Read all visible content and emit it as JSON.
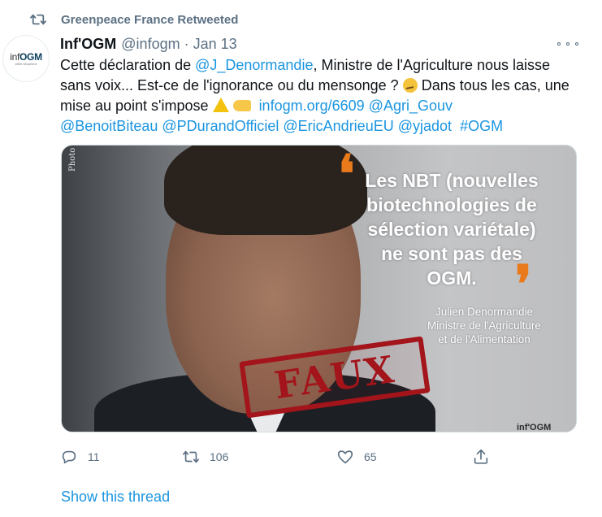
{
  "social_context": {
    "icon": "retweet-icon",
    "text": "Greenpeace France Retweeted"
  },
  "author": {
    "name": "Inf'OGM",
    "handle": "@infogm",
    "separator": "·",
    "date": "Jan 13",
    "avatar_logo_inf": "inf",
    "avatar_logo_ogm": "OGM",
    "avatar_tagline": "veille citoyenne"
  },
  "tweet": {
    "t1": "Cette déclaration de ",
    "mention_1": "@J_Denormandie",
    "t2": ", Ministre de l'Agriculture nous laisse sans voix... Est-ce de l'ignorance ou du mensonge ? ",
    "t3": " Dans tous les cas, une mise au point s'impose ",
    "link": "infogm.org/6609",
    "mention_2": "@Agri_Gouv",
    "mention_3": "@BenoitBiteau",
    "mention_4": "@PDurandOfficiel",
    "mention_5": "@EricAndrieuEU",
    "mention_6": "@yjadot",
    "hashtag": "#OGM",
    "emojis": [
      "thinking-face-icon",
      "warning-icon",
      "pointing-hand-icon"
    ]
  },
  "media": {
    "photo_credit": "Photo : A",
    "quote": "Les NBT (nouvelles biotechnologies de sélection variétale) ne sont pas des OGM.",
    "quote_author_name": "Julien Denormandie",
    "quote_author_role_1": "Ministre de l'Agriculture",
    "quote_author_role_2": "et de l'Alimentation",
    "stamp": "FAUX",
    "watermark": "inf'OGM",
    "accent_color": "#e87a1c",
    "stamp_color": "#a3141b"
  },
  "actions": {
    "reply_count": "11",
    "retweet_count": "106",
    "like_count": "65"
  },
  "show_thread": "Show this thread",
  "colors": {
    "link": "#1b95e0",
    "muted": "#5b7083",
    "text": "#0f1419"
  }
}
